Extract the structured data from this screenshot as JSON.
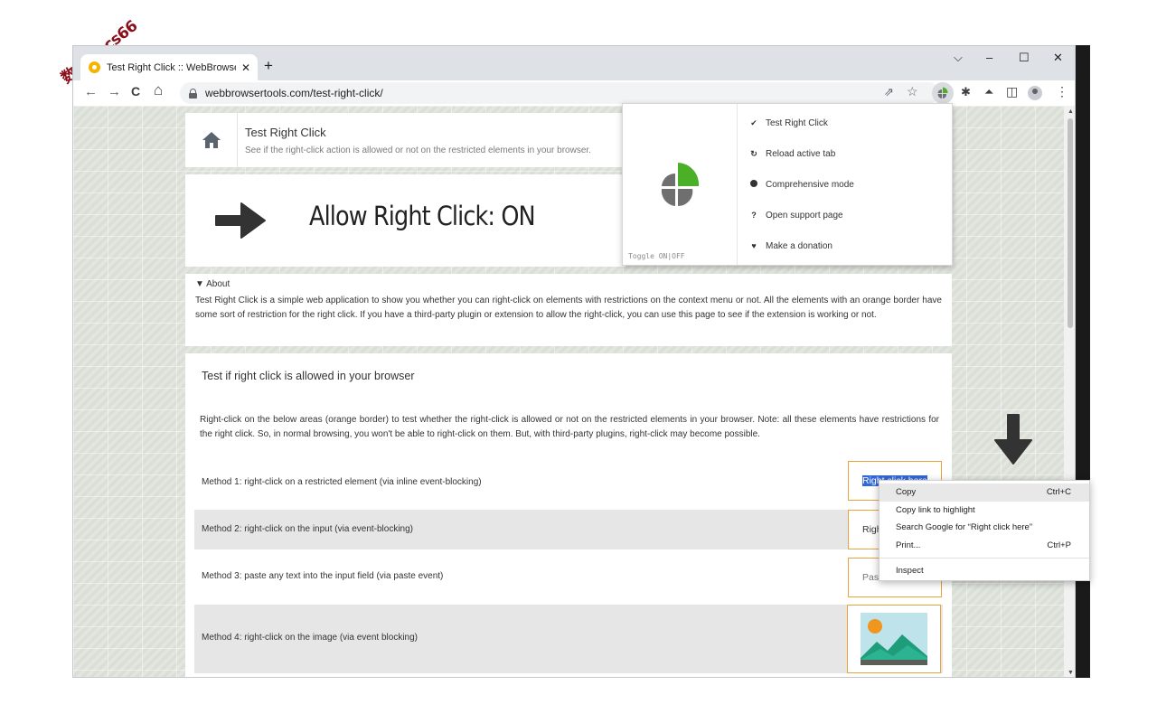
{
  "watermark": {
    "text": "数创社scs66"
  },
  "browser": {
    "tab": {
      "title": "Test Right Click :: WebBrowserTools",
      "close": "✕"
    },
    "new_tab": "+",
    "window_controls": {
      "dropdown": "⌵",
      "minimize": "–",
      "maximize": "☐",
      "close": "✕"
    },
    "nav": {
      "back": "←",
      "forward": "→",
      "reload": "C",
      "home": "⌂"
    },
    "url": "webbrowsertools.com/test-right-click/",
    "toolbar_icons": {
      "share": "⇗",
      "star": "☆",
      "puzzle": "✱",
      "lab": "⏶",
      "sidepanel": "◫",
      "menu": "⋮"
    }
  },
  "page": {
    "title": "Test Right Click",
    "subtitle": "See if the right-click action is allowed or not on the restricted elements in your browser.",
    "status": "Allow Right Click: ON",
    "about": {
      "toggle": "▼ About",
      "text": "Test Right Click is a simple web application to show you whether you can right-click on elements with restrictions on the context menu or not. All the elements with an orange border have some sort of restriction for the right click. If you have a third-party plugin or extension to allow the right-click, you can use this page to see if the extension is working or not."
    },
    "test": {
      "heading": "Test if right click is allowed in your browser",
      "description": "Right-click on the below areas (orange border) to test whether the right-click is allowed or not on the restricted elements in your browser. Note: all these elements have restrictions for the right click. So, in normal browsing, you won't be able to right-click on them. But, with third-party plugins, right-click may become possible.",
      "methods": [
        {
          "label": "Method 1: right-click on a restricted element (via inline event-blocking)",
          "box": "Right click here"
        },
        {
          "label": "Method 2: right-click on the input (via event-blocking)",
          "box": "Right click here"
        },
        {
          "label": "Method 3: paste any text into the input field (via paste event)",
          "box": "Paste text here"
        },
        {
          "label": "Method 4: right-click on the image (via event blocking)"
        }
      ]
    }
  },
  "extension_popup": {
    "toggle_label": "Toggle ON|OFF",
    "items": [
      {
        "icon": "check-icon",
        "label": "Test Right Click"
      },
      {
        "icon": "reload-icon",
        "label": "Reload active tab"
      },
      {
        "icon": "circle-icon",
        "label": "Comprehensive mode"
      },
      {
        "icon": "question-icon",
        "label": "Open support page"
      },
      {
        "icon": "heart-icon",
        "label": "Make a donation"
      }
    ],
    "logo_colors": {
      "gray": "#6f6f6f",
      "green": "#4caf28"
    }
  },
  "context_menu": {
    "items": [
      {
        "label": "Copy",
        "shortcut": "Ctrl+C"
      },
      {
        "label": "Copy link to highlight",
        "shortcut": ""
      },
      {
        "label": "Search Google for “Right click here”",
        "shortcut": ""
      },
      {
        "label": "Print...",
        "shortcut": "Ctrl+P"
      },
      {
        "label": "Inspect",
        "shortcut": ""
      }
    ]
  },
  "colors": {
    "accent_border": "#e8a33d",
    "selection": "#3367d6"
  }
}
